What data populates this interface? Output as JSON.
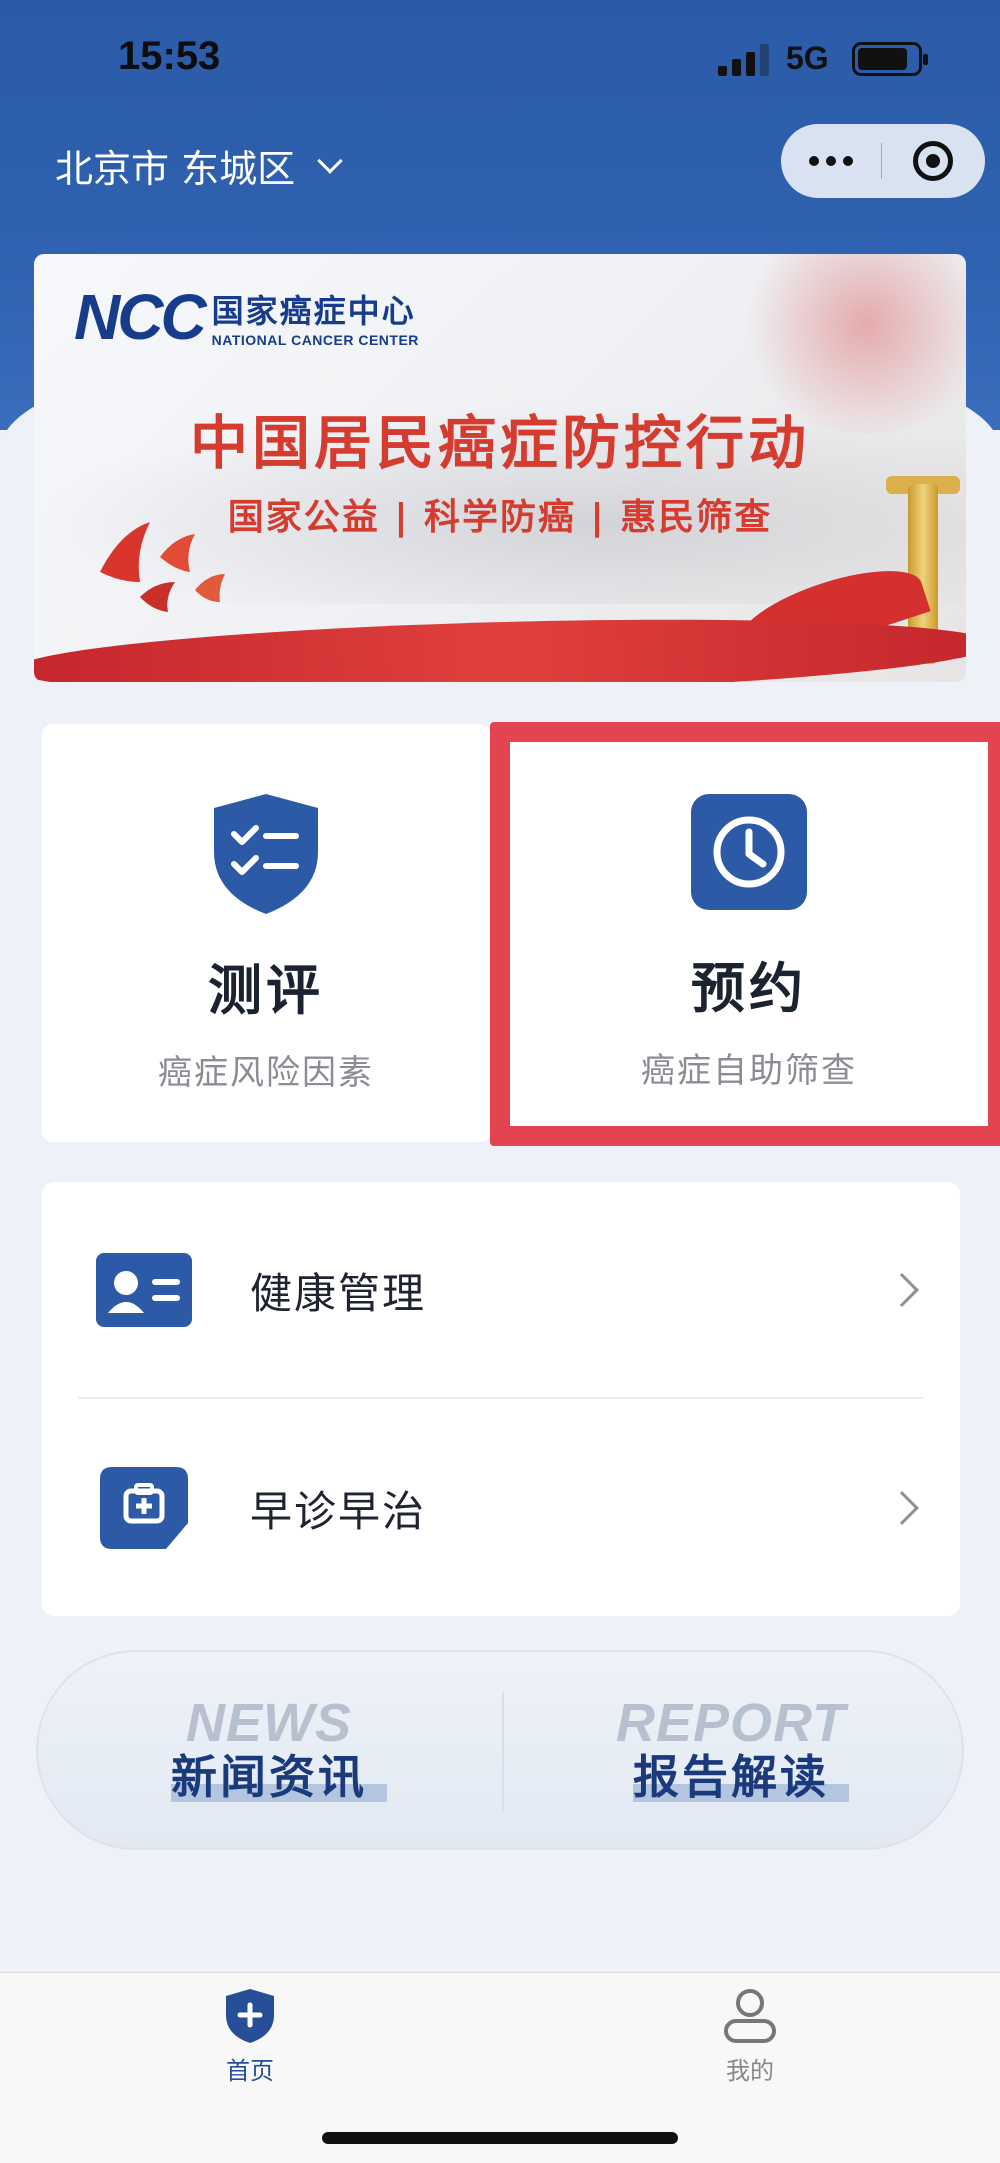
{
  "status_bar": {
    "time": "15:53",
    "network": "5G",
    "battery_level": 0.85
  },
  "header": {
    "location": "北京市 东城区"
  },
  "banner": {
    "logo_mark": "NCC",
    "logo_cn": "国家癌症中心",
    "logo_en": "NATIONAL CANCER CENTER",
    "title": "中国居民癌症防控行动",
    "subtitle": "国家公益 | 科学防癌 | 惠民筛查"
  },
  "cards": [
    {
      "title": "测评",
      "subtitle": "癌症风险因素",
      "icon": "checklist-shield-icon"
    },
    {
      "title": "预约",
      "subtitle": "癌症自助筛查",
      "icon": "clock-icon"
    }
  ],
  "list": [
    {
      "label": "健康管理",
      "icon": "id-card-icon"
    },
    {
      "label": "早诊早治",
      "icon": "medical-kit-icon"
    }
  ],
  "news": [
    {
      "en": "NEWS",
      "cn": "新闻资讯"
    },
    {
      "en": "REPORT",
      "cn": "报告解读"
    }
  ],
  "tabs": [
    {
      "label": "首页",
      "icon": "home-shield-icon",
      "active": true
    },
    {
      "label": "我的",
      "icon": "user-icon",
      "active": false
    }
  ],
  "colors": {
    "primary": "#2b5aa8",
    "highlight": "#e2454f",
    "accent_red": "#d53c2f"
  }
}
